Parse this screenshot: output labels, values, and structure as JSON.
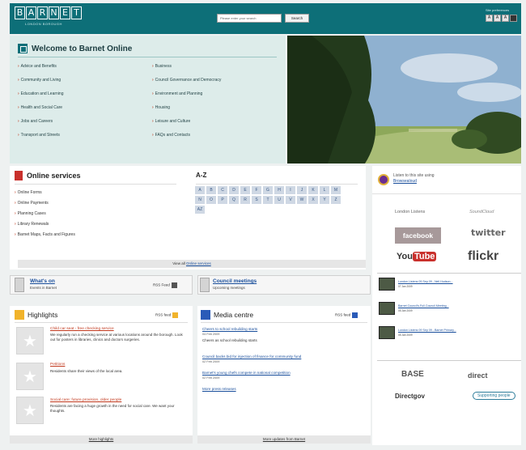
{
  "header": {
    "logo_letters": [
      "B",
      "A",
      "R",
      "N",
      "E",
      "T"
    ],
    "logo_sub": "LONDON BOROUGH",
    "search_placeholder": "Please enter your search",
    "search_button": "Search",
    "prefs_label": "Site preferences",
    "font_buttons": [
      "A",
      "A",
      "A"
    ]
  },
  "welcome": {
    "title": "Welcome to Barnet Online",
    "left_links": [
      "Advice and Benefits",
      "Community and Living",
      "Education and Learning",
      "Health and Social Care",
      "Jobs and Careers",
      "Transport and Streets"
    ],
    "right_links": [
      "Business",
      "Council Governance and Democracy",
      "Environment and Planning",
      "Housing",
      "Leisure and Culture",
      "FAQs and Contacts"
    ]
  },
  "online_services": {
    "title": "Online services",
    "links": [
      "Online Forms",
      "Online Payments",
      "Planning Cases",
      "Library Renewals",
      "Barnet Maps, Facts and Figures"
    ],
    "footer_prefix": "View all",
    "footer_link": "Online services"
  },
  "az": {
    "title": "A-Z",
    "letters": [
      "A",
      "B",
      "C",
      "D",
      "E",
      "F",
      "G",
      "H",
      "I",
      "J",
      "K",
      "L",
      "M",
      "N",
      "O",
      "P",
      "Q",
      "R",
      "S",
      "T",
      "U",
      "V",
      "W",
      "X",
      "Y",
      "Z",
      "AZ"
    ]
  },
  "whats_on": {
    "title": "What's on",
    "subtitle": "Events in Barnet",
    "rss": "RSS Feed"
  },
  "council_meetings": {
    "title": "Council meetings",
    "subtitle": "Upcoming meetings"
  },
  "highlights": {
    "title": "Highlights",
    "rss": "RSS feed",
    "items": [
      {
        "link": "Child car seat - free checking service",
        "desc": "We regularly run a checking service at various locations around the borough. Look out for posters in libraries, clinics and doctors surgeries."
      },
      {
        "link": "Petitions",
        "desc": "Residents share their views of the local area."
      },
      {
        "link": "Social care: future provision, older people",
        "desc": "Residents are facing a huge growth in the need for social care. We want your thoughts."
      }
    ],
    "footer": "More highlights"
  },
  "media_centre": {
    "title": "Media centre",
    "rss": "RSS feed",
    "items": [
      {
        "link": "Cheers to school rebuilding starts",
        "date": "04 Feb 2009",
        "desc": "Cheers as school rebuilding starts"
      },
      {
        "link": "Council backs bid for injection of finance for community fund",
        "date": "02 Feb 2009"
      },
      {
        "link": "Barnet's young chefs compete in national competition",
        "date": "02 Feb 2009"
      },
      {
        "link": "More press releases"
      }
    ],
    "footer": "More updates from Barnet"
  },
  "right_column": {
    "listen_text": "Listen to this site using",
    "listen_link": "Browsealoud",
    "london_listens": "London Listens",
    "soundcloud": "SoundCloud",
    "facebook": "facebook",
    "twitter": "twitter",
    "youtube_you": "You",
    "youtube_tube": "Tube",
    "flickr": "flickr",
    "videos": [
      {
        "title": "London Listens 09 Sep 09 - Neil Hudson...",
        "date": "07 Jan 2009"
      },
      {
        "title": "Barnet Council's Full Council Meeting...",
        "date": "05 Jan 2009"
      },
      {
        "title": "London Listens 09 Sep 09 - Barnet Primary...",
        "date": "05 Jan 2009"
      }
    ],
    "base": "BASE",
    "direct": "direct",
    "directgov": "Directgov",
    "partner": "Supporting people"
  }
}
